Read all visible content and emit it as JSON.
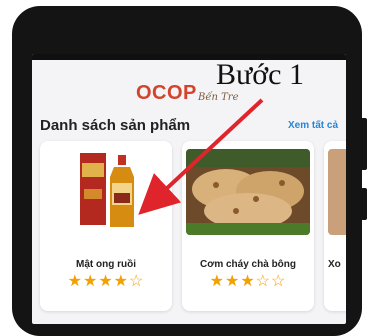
{
  "header": {
    "logo_text_red": "OCOP",
    "logo_subtext": "Bến Tre"
  },
  "section": {
    "title": "Danh sách sản phẩm",
    "see_all_label": "Xem tất cả"
  },
  "products": [
    {
      "name": "Mật ong ruồi",
      "rating": 4,
      "max_rating": 5,
      "stars_text": "★★★★☆"
    },
    {
      "name": "Cơm cháy chà bông",
      "rating": 3,
      "max_rating": 5,
      "stars_text": "★★★☆☆"
    },
    {
      "name": "Xo"
    }
  ],
  "annotation": {
    "label": "Bước 1",
    "color": "#e0242b"
  },
  "colors": {
    "accent_link": "#2486d9",
    "star": "#f3a100"
  }
}
